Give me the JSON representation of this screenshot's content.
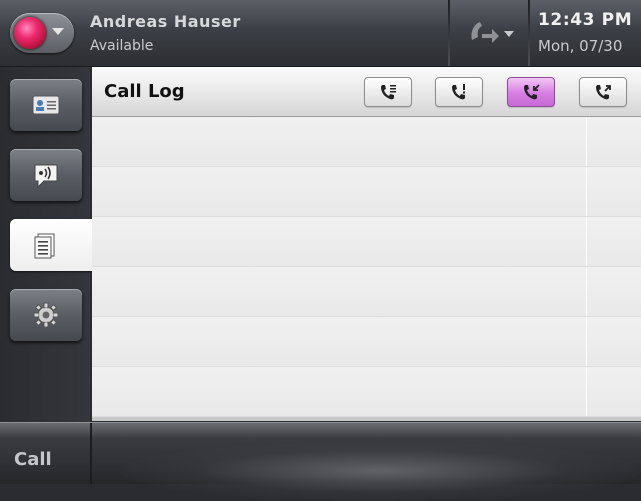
{
  "header": {
    "user_name": "Andreas Hauser",
    "presence_status": "Available",
    "time": "12:43 PM",
    "date": "Mon, 07/30"
  },
  "sidebar": {
    "items": [
      {
        "name": "contacts",
        "icon": "contact-card-icon"
      },
      {
        "name": "voicemail",
        "icon": "speaker-bubble-icon"
      },
      {
        "name": "call-log",
        "icon": "document-list-icon",
        "active": true
      },
      {
        "name": "settings",
        "icon": "gear-icon"
      }
    ]
  },
  "main": {
    "title": "Call Log",
    "filters": [
      {
        "name": "all-calls",
        "icon": "phone-list-icon"
      },
      {
        "name": "missed-calls",
        "icon": "phone-missed-icon"
      },
      {
        "name": "received-calls",
        "icon": "phone-incoming-icon",
        "active": true
      },
      {
        "name": "placed-calls",
        "icon": "phone-outgoing-icon"
      }
    ],
    "rows": [
      "",
      "",
      "",
      "",
      "",
      ""
    ]
  },
  "footer": {
    "call_label": "Call"
  },
  "colors": {
    "active_filter": "#d77ee2",
    "presence_available": "#ee2a6e"
  }
}
